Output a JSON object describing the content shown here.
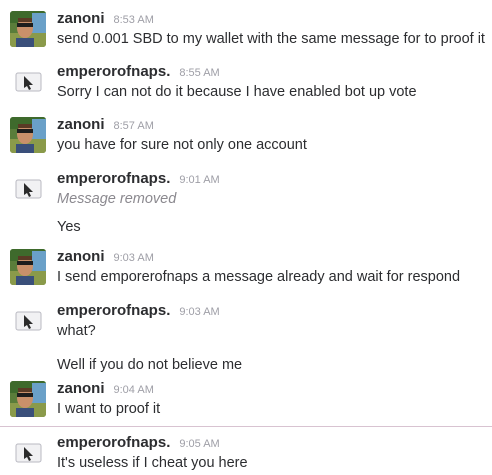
{
  "messages": [
    {
      "user": "zanoni",
      "avatar_icon": "zanoni-avatar",
      "time": "8:53 AM",
      "lines": [
        {
          "text": "send 0.001 SBD to my wallet with the same message for to proof it",
          "removed": false
        }
      ]
    },
    {
      "user": "emperorofnaps.",
      "avatar_icon": "bot-avatar",
      "time": "8:55 AM",
      "lines": [
        {
          "text": "Sorry I can not do it because I have enabled bot up vote",
          "removed": false
        }
      ]
    },
    {
      "user": "zanoni",
      "avatar_icon": "zanoni-avatar",
      "time": "8:57 AM",
      "lines": [
        {
          "text": "you have for sure not only one account",
          "removed": false
        }
      ]
    },
    {
      "user": "emperorofnaps.",
      "avatar_icon": "bot-avatar",
      "time": "9:01 AM",
      "lines": [
        {
          "text": "Message removed",
          "removed": true
        },
        {
          "text": "Yes",
          "removed": false
        }
      ]
    },
    {
      "user": "zanoni",
      "avatar_icon": "zanoni-avatar",
      "time": "9:03 AM",
      "lines": [
        {
          "text": "I send emporerofnaps a message already and wait for respond",
          "removed": false
        }
      ]
    },
    {
      "user": "emperorofnaps.",
      "avatar_icon": "bot-avatar",
      "time": "9:03 AM",
      "lines": [
        {
          "text": "what?",
          "removed": false
        },
        {
          "text": "Well if you do not believe me",
          "removed": false
        }
      ]
    },
    {
      "user": "zanoni",
      "avatar_icon": "zanoni-avatar",
      "time": "9:04 AM",
      "lines": [
        {
          "text": "I want to proof it",
          "removed": false
        }
      ]
    },
    {
      "user": "emperorofnaps.",
      "avatar_icon": "bot-avatar",
      "time": "9:05 AM",
      "lines": [
        {
          "text": "It's useless if I cheat you here",
          "removed": false
        }
      ]
    }
  ],
  "colors": {
    "name": "#2c2d30",
    "time": "#9e9ea6",
    "text": "#2c2d30",
    "removed_text": "#8b898f",
    "divider": "#d8c3d1"
  }
}
